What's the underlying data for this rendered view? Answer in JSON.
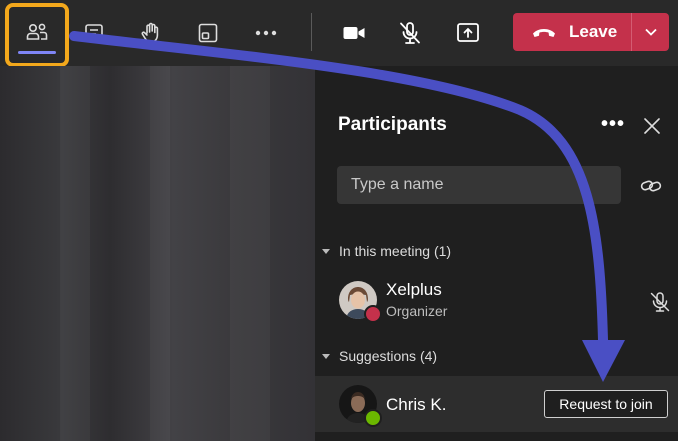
{
  "toolbar": {
    "buttons": [
      {
        "name": "people-icon"
      },
      {
        "name": "chat-icon"
      },
      {
        "name": "raise-hand-icon"
      },
      {
        "name": "rooms-icon"
      },
      {
        "name": "more-icon"
      },
      {
        "name": "camera-icon"
      },
      {
        "name": "mic-off-icon"
      },
      {
        "name": "share-icon"
      }
    ],
    "leave_label": "Leave",
    "leave_color": "#c4314b",
    "highlight_color": "#f3a81c",
    "arrow_color": "#4a4fc4"
  },
  "panel": {
    "title": "Participants",
    "search_placeholder": "Type a name",
    "in_meeting_label": "In this meeting (1)",
    "suggestions_label": "Suggestions (4)",
    "organizer": {
      "name": "Xelplus",
      "role": "Organizer",
      "status_color": "#c4314b"
    },
    "suggestion": {
      "name": "Chris K.",
      "action_label": "Request to join",
      "status_color": "#6bb700"
    }
  }
}
